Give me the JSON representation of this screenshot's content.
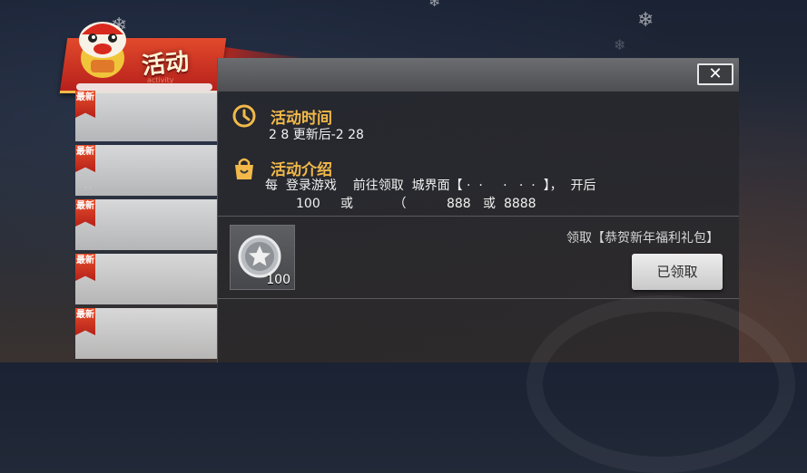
{
  "banner": {
    "title": "活动",
    "subtitle": "activity"
  },
  "sidebar": {
    "items": [
      {
        "badge": "最新",
        "faint": ""
      },
      {
        "badge": "最新",
        "faint": "· ·"
      },
      {
        "badge": "最新",
        "faint": ""
      },
      {
        "badge": "最新",
        "faint": ""
      },
      {
        "badge": "最新",
        "faint": ""
      }
    ]
  },
  "panel": {
    "close_label": "✕",
    "time_section": {
      "title": "活动时间",
      "text": "2 8 更新后-2 28"
    },
    "intro_section": {
      "title": "活动介绍",
      "line1": "每  登录游戏    前往领取  城界面【 ·  ·     ·   ·  ·  】，  开后",
      "line2": "100     或          （          888   或  8888"
    },
    "reward": {
      "count": "100",
      "icon": "silver-star-coin-icon"
    },
    "claim": {
      "description": "领取【恭贺新年福利礼包】",
      "button_label": "已领取"
    }
  },
  "colors": {
    "accent": "#f2b94a",
    "banner_red": "#d2361f"
  }
}
